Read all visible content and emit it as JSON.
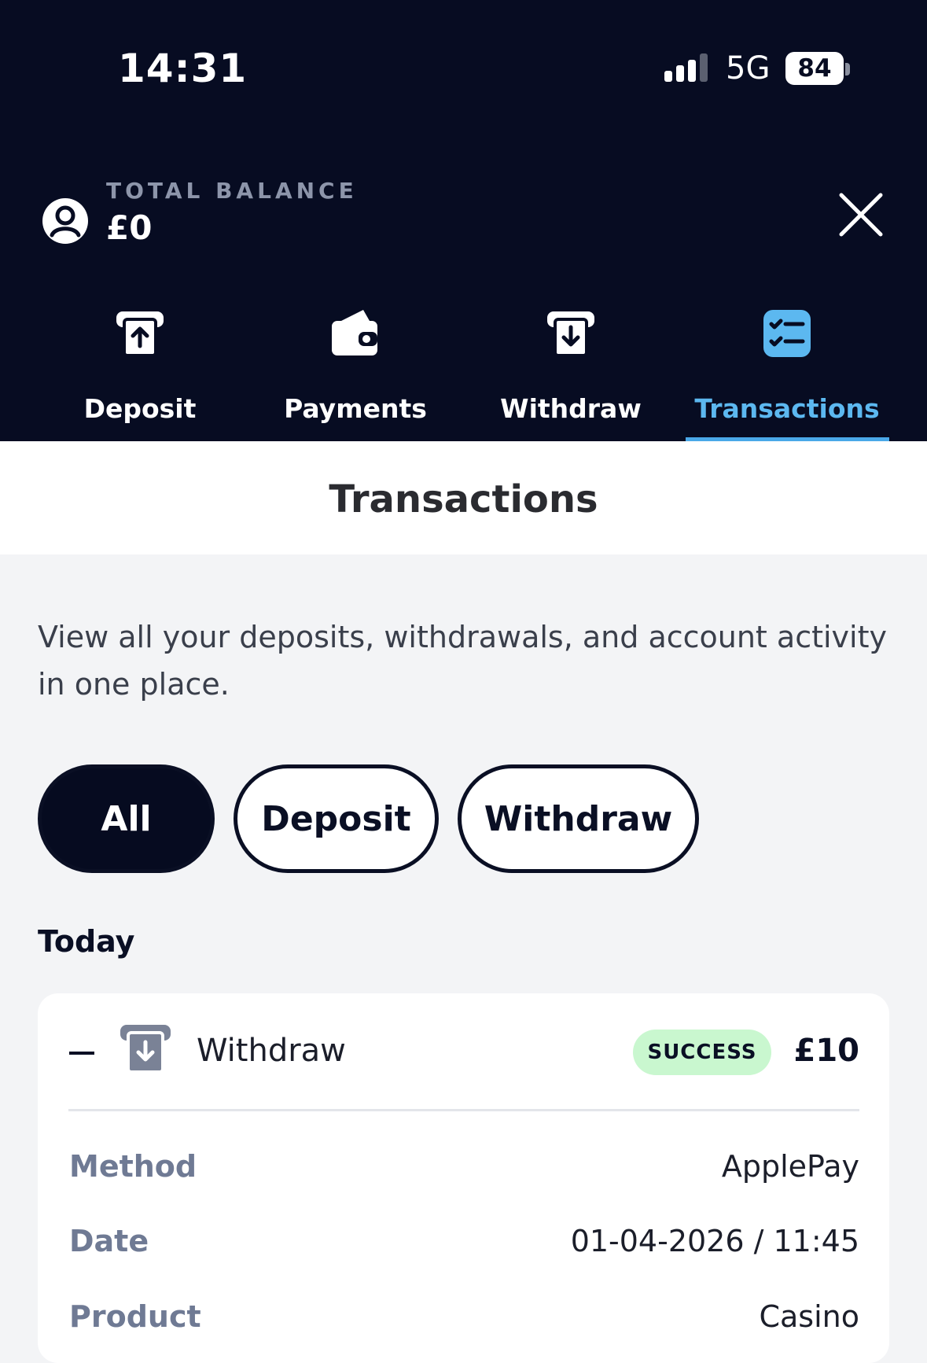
{
  "status_bar": {
    "time": "14:31",
    "network": "5G",
    "battery": "84",
    "icons": [
      "signal-icon",
      "battery-icon"
    ]
  },
  "header": {
    "balance_label": "TOTAL BALANCE",
    "balance_value": "£0",
    "icons": [
      "user-icon",
      "close-icon"
    ]
  },
  "nav": {
    "tabs": [
      {
        "label": "Deposit",
        "icon": "deposit-icon",
        "active": false
      },
      {
        "label": "Payments",
        "icon": "wallet-icon",
        "active": false
      },
      {
        "label": "Withdraw",
        "icon": "withdraw-icon",
        "active": false
      },
      {
        "label": "Transactions",
        "icon": "transactions-list-icon",
        "active": true
      }
    ]
  },
  "page": {
    "title": "Transactions",
    "intro": "View all your deposits, withdrawals, and account activity in one place."
  },
  "filters": {
    "options": [
      "All",
      "Deposit",
      "Withdraw"
    ],
    "selected": "All"
  },
  "transactions": {
    "section_label": "Today",
    "items": [
      {
        "type": "Withdraw",
        "icon": "withdraw-icon",
        "status": "SUCCESS",
        "amount": "£10",
        "details": [
          {
            "label": "Method",
            "value": "ApplePay"
          },
          {
            "label": "Date",
            "value": "01-04-2026 / 11:45"
          },
          {
            "label": "Product",
            "value": "Casino"
          }
        ]
      }
    ]
  },
  "colors": {
    "header_bg": "#070c22",
    "accent": "#5cb8f0",
    "success_bg": "#c9f7cf",
    "muted_label": "#6f7a94"
  }
}
